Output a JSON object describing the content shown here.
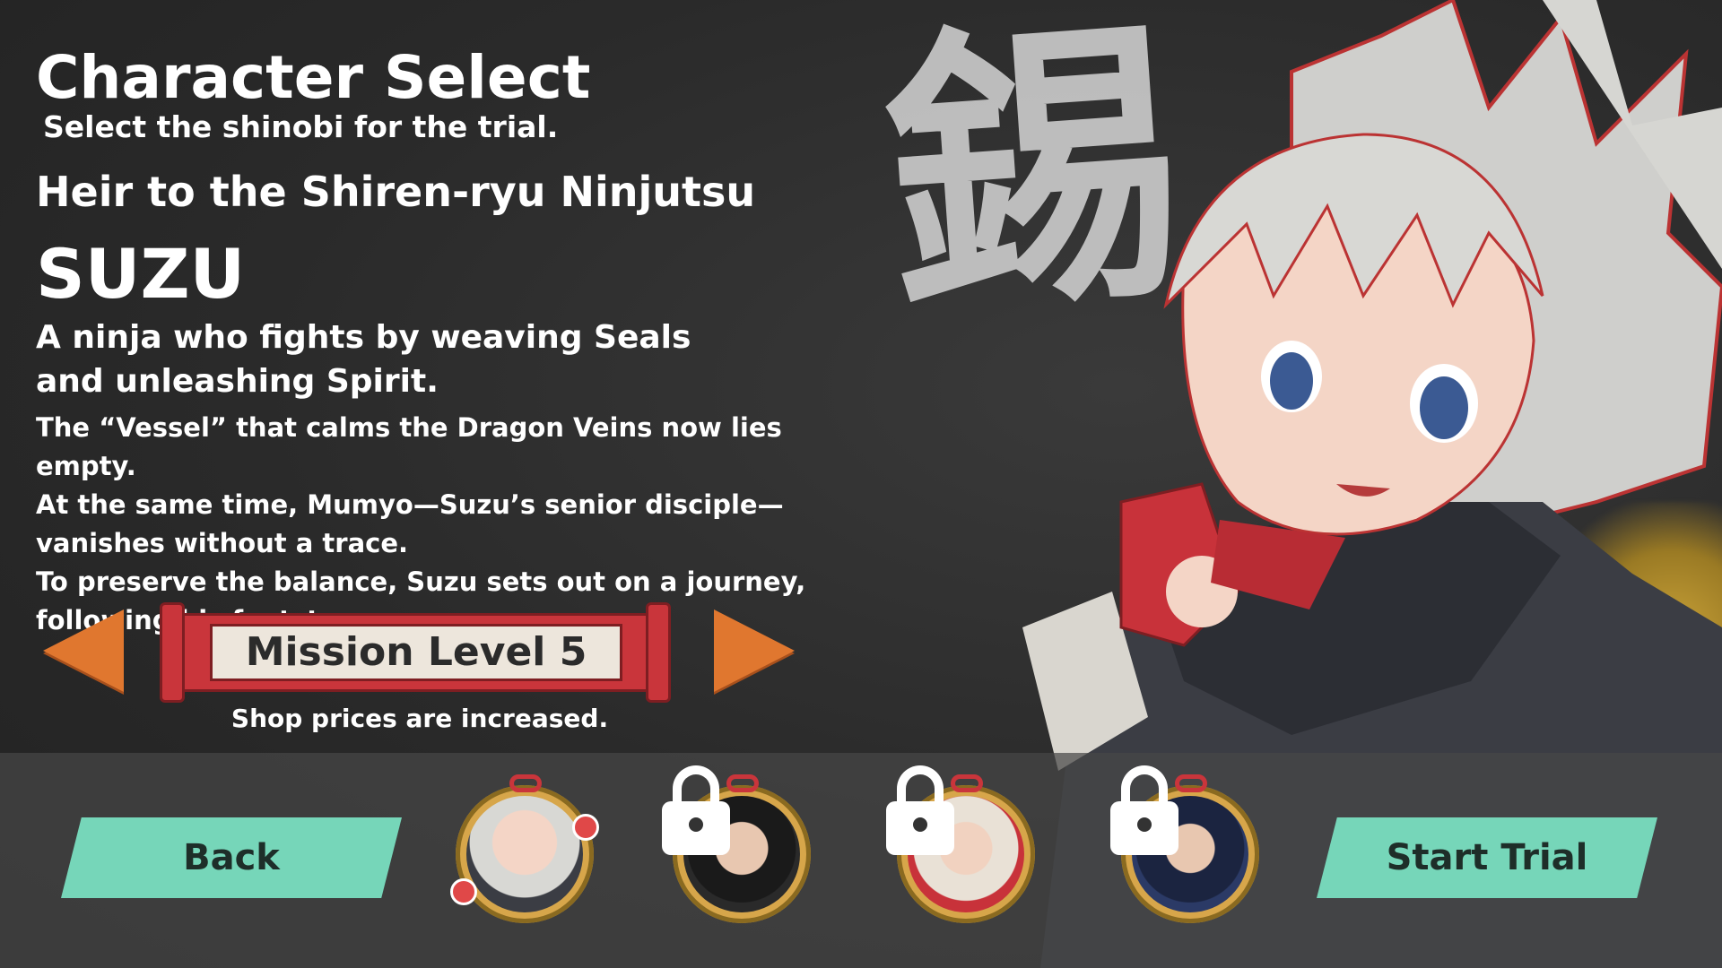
{
  "screen": {
    "title": "Character Select",
    "subtitle": "Select the shinobi for the trial."
  },
  "character": {
    "epithet": "Heir to the Shiren-ryu Ninjutsu",
    "name": "SUZU",
    "tagline": "A ninja who fights by weaving Seals and unleashing Spirit.",
    "story": [
      "The “Vessel” that calms the Dragon Veins now lies empty.",
      "At the same time, Mumyo—Suzu’s senior disciple—vanishes without a trace.",
      "To preserve the balance, Suzu sets out on a journey, following his footsteps."
    ],
    "kanji": "錫"
  },
  "mission": {
    "label": "Mission Level 5",
    "note": "Shop prices are increased."
  },
  "buttons": {
    "back": "Back",
    "start": "Start Trial"
  },
  "roster": [
    {
      "id": "suzu",
      "locked": false,
      "selected": true
    },
    {
      "id": "locked-1",
      "locked": true,
      "selected": false
    },
    {
      "id": "locked-2",
      "locked": true,
      "selected": false
    },
    {
      "id": "locked-3",
      "locked": true,
      "selected": false
    }
  ],
  "colors": {
    "accent_button": "#76d6b9",
    "arrow": "#e0772f",
    "scroll_red": "#c9353b",
    "paper": "#ede6dc"
  }
}
